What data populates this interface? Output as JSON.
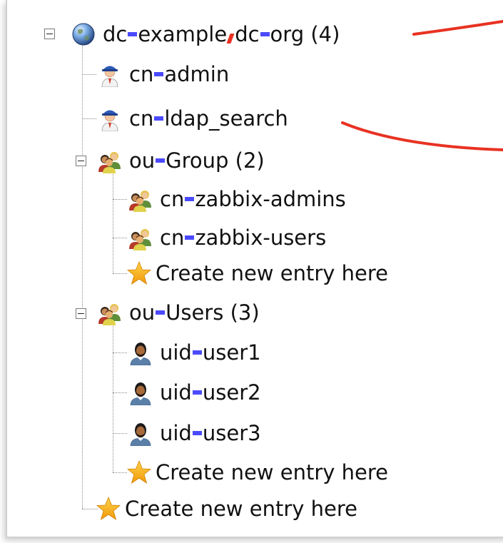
{
  "tree": {
    "root": {
      "prefix1": "dc",
      "value1": "example",
      "prefix2": "dc",
      "value2": "org",
      "count": "(4)",
      "icon": "globe-icon"
    },
    "admin": {
      "prefix": "cn",
      "value": "admin",
      "icon": "admin-user-icon"
    },
    "ldap_search": {
      "prefix": "cn",
      "value": "ldap_search",
      "icon": "admin-user-icon"
    },
    "group": {
      "prefix": "ou",
      "value": "Group",
      "count": "(2)",
      "icon": "group-icon",
      "children": [
        {
          "prefix": "cn",
          "value": "zabbix-admins",
          "icon": "group-icon"
        },
        {
          "prefix": "cn",
          "value": "zabbix-users",
          "icon": "group-icon"
        }
      ],
      "create_label": "Create new entry here"
    },
    "users": {
      "prefix": "ou",
      "value": "Users",
      "count": "(3)",
      "icon": "group-icon",
      "children": [
        {
          "prefix": "uid",
          "value": "user1",
          "icon": "person-icon"
        },
        {
          "prefix": "uid",
          "value": "user2",
          "icon": "person-icon"
        },
        {
          "prefix": "uid",
          "value": "user3",
          "icon": "person-icon"
        }
      ],
      "create_label": "Create new entry here"
    },
    "root_create_label": "Create new entry here"
  },
  "colors": {
    "equals_mark": "#4a4aff",
    "comma_mark": "#e83222",
    "annotation_arrow": "#e83222",
    "star": "#f4a010"
  }
}
